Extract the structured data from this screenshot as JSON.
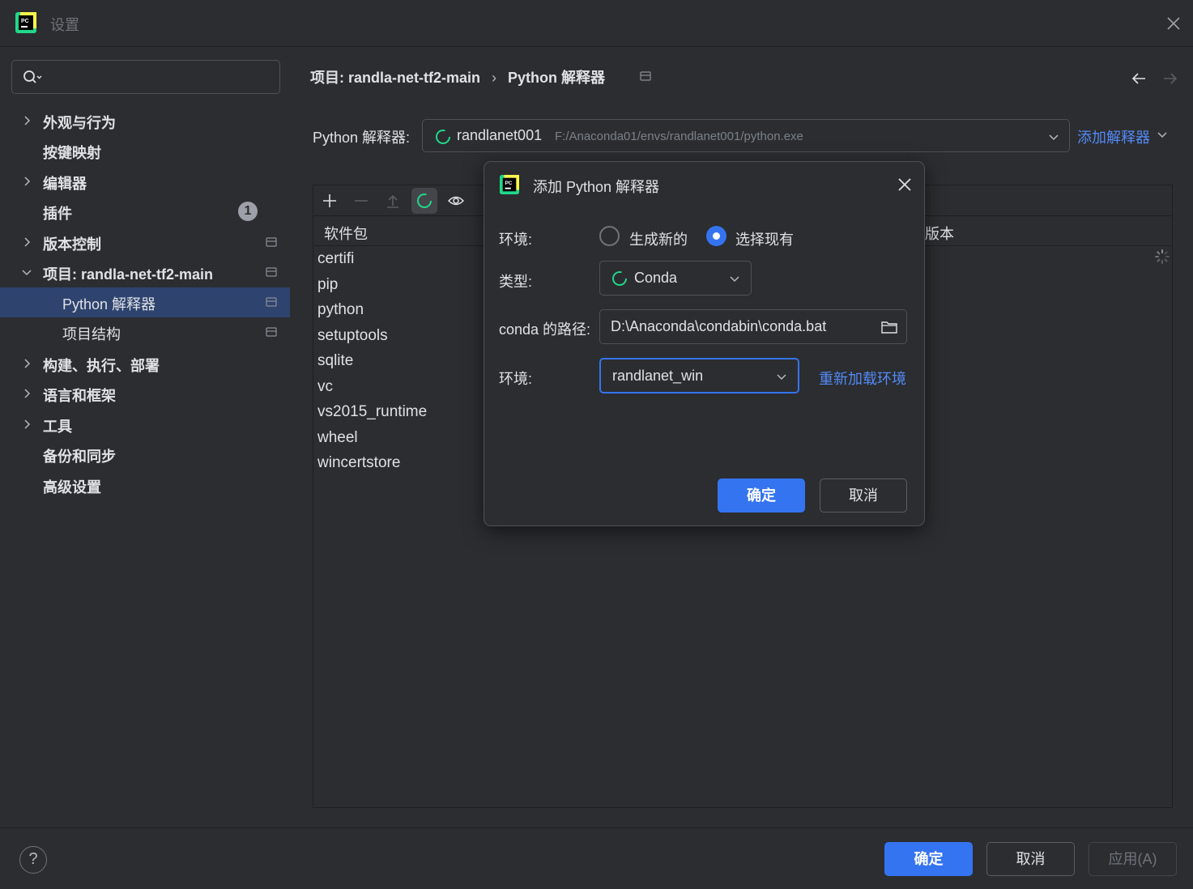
{
  "window": {
    "title": "设置"
  },
  "sidebar": {
    "search": {
      "placeholder": ""
    },
    "items": [
      {
        "label": "外观与行为"
      },
      {
        "label": "按键映射"
      },
      {
        "label": "编辑器"
      },
      {
        "label": "插件",
        "badge": "1"
      },
      {
        "label": "版本控制"
      },
      {
        "label": "项目: randla-net-tf2-main"
      },
      {
        "label": "Python 解释器"
      },
      {
        "label": "项目结构"
      },
      {
        "label": "构建、执行、部署"
      },
      {
        "label": "语言和框架"
      },
      {
        "label": "工具"
      },
      {
        "label": "备份和同步"
      },
      {
        "label": "高级设置"
      }
    ]
  },
  "breadcrumb": {
    "project": "项目: randla-net-tf2-main",
    "sep": "›",
    "page": "Python 解释器"
  },
  "interpreter": {
    "label": "Python 解释器:",
    "name": "randlanet001",
    "path": "F:/Anaconda01/envs/randlanet001/python.exe",
    "add_label": "添加解释器"
  },
  "packages": {
    "col_name": "软件包",
    "col_version": "版本",
    "rows": [
      "certifi",
      "pip",
      "python",
      "setuptools",
      "sqlite",
      "vc",
      "vs2015_runtime",
      "wheel",
      "wincertstore"
    ]
  },
  "dialog": {
    "title": "添加 Python 解释器",
    "env_label": "环境:",
    "radio_new": "生成新的",
    "radio_existing": "选择现有",
    "type_label": "类型:",
    "type_value": "Conda",
    "conda_path_label": "conda 的路径:",
    "conda_path_value": "D:\\Anaconda\\condabin\\conda.bat",
    "env2_label": "环境:",
    "env_value": "randlanet_win",
    "reload_label": "重新加载环境",
    "ok_label": "确定",
    "cancel_label": "取消"
  },
  "footer": {
    "help": "?",
    "ok_label": "确定",
    "cancel_label": "取消",
    "apply_label": "应用(A)"
  },
  "colors": {
    "accent": "#3574f0",
    "link": "#548af7",
    "background": "#2b2d30",
    "selection": "#2e436e"
  }
}
